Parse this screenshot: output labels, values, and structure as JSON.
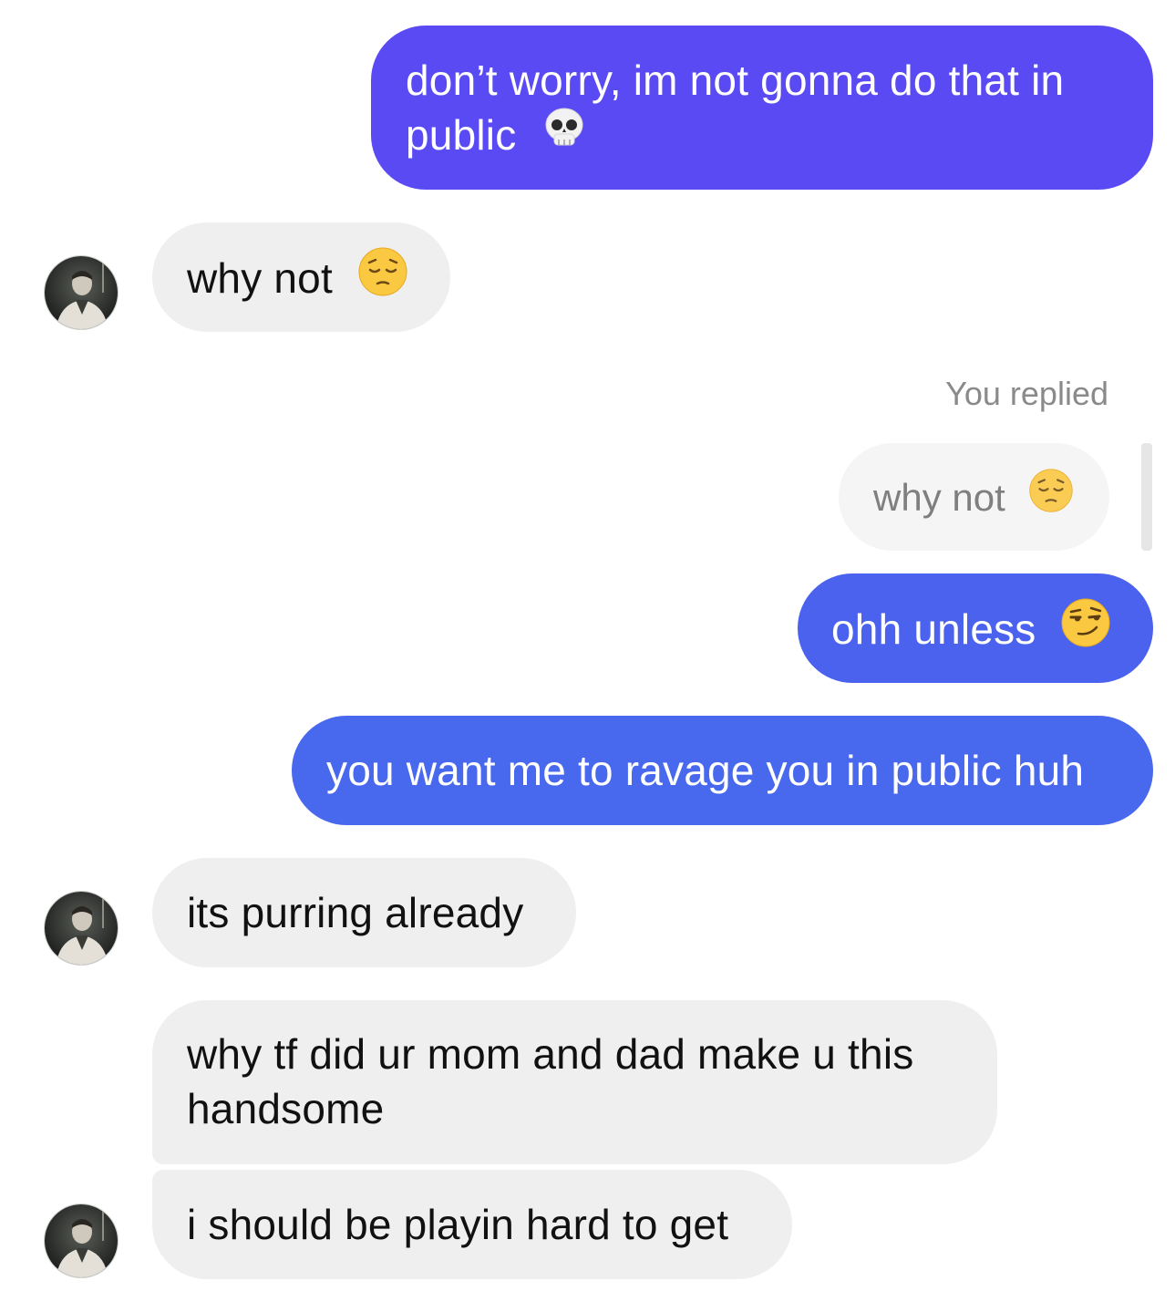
{
  "messages": [
    {
      "id": "m1",
      "text": "don’t worry, im not gonna do that in public",
      "emoji": "skull-emoji"
    },
    {
      "id": "m2",
      "text": "why not",
      "emoji": "pensive-emoji"
    },
    {
      "id": "m3",
      "reply_label": "You replied",
      "quote_text": "why not",
      "quote_emoji": "pensive-emoji"
    },
    {
      "id": "m4",
      "text": "ohh unless",
      "emoji": "smirk-emoji"
    },
    {
      "id": "m5",
      "text": "you want me to ravage you in public huh"
    },
    {
      "id": "m6",
      "text": "its purring already"
    },
    {
      "id": "m7",
      "text": "why tf did ur mom and dad make u this handsome"
    },
    {
      "id": "m8",
      "text": "i should be playin hard to get"
    }
  ],
  "colors": {
    "outgoing_top": "#5a4af4",
    "outgoing_mid": "#4a62ee",
    "outgoing_bottom": "#4868ee",
    "incoming_bg": "#efefef",
    "quote_bg": "#f5f5f5",
    "meta_text": "#8a8a8a"
  }
}
